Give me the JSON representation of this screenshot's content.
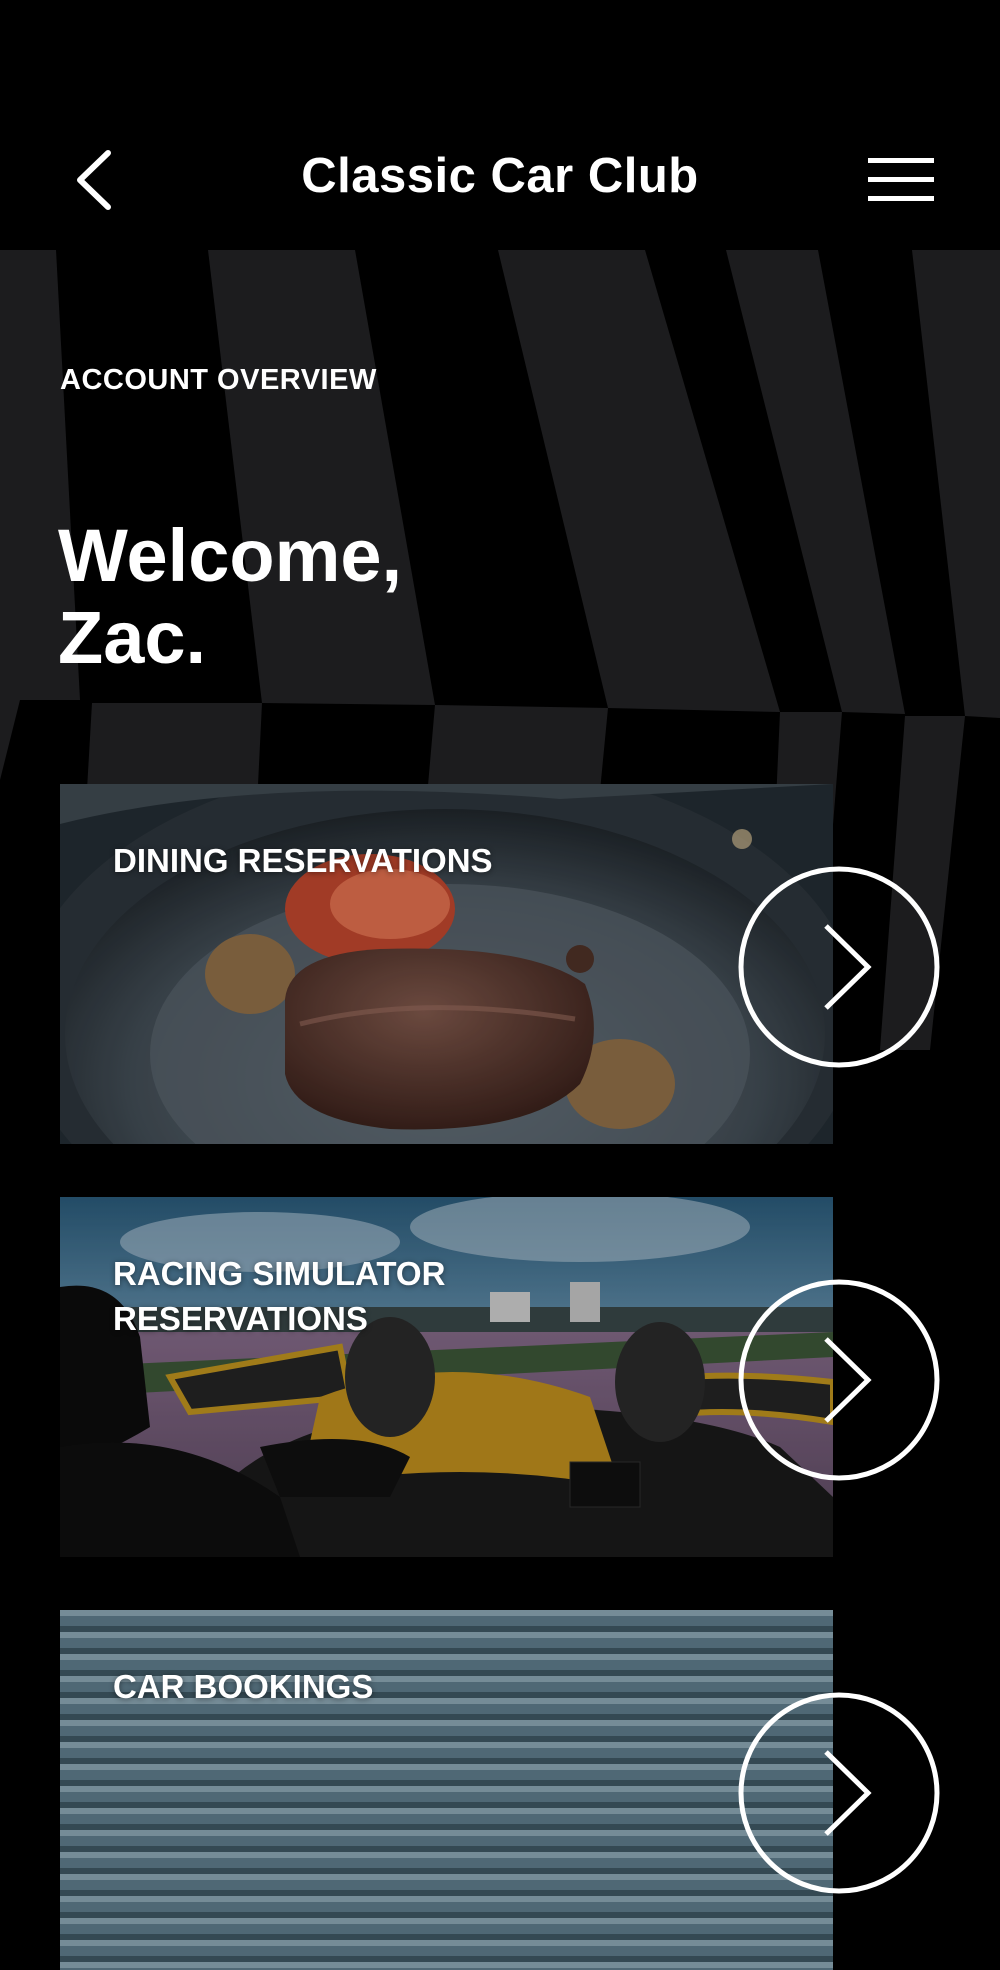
{
  "header": {
    "title": "Classic Car Club",
    "back_icon": "chevron-left-icon",
    "menu_icon": "hamburger-menu-icon"
  },
  "account": {
    "eyebrow": "ACCOUNT OVERVIEW",
    "welcome_line1": "Welcome,",
    "welcome_line2": "Zac."
  },
  "cards": [
    {
      "label": "DINING RESERVATIONS",
      "image": "steak-dish-photo",
      "icon": "chevron-right-circle-icon"
    },
    {
      "label_line1": "RACING SIMULATOR",
      "label_line2": "RESERVATIONS",
      "image": "racing-simulator-photo",
      "icon": "chevron-right-circle-icon"
    },
    {
      "label": "CAR BOOKINGS",
      "image": "garage-door-photo",
      "icon": "chevron-right-circle-icon"
    }
  ],
  "colors": {
    "background": "#000000",
    "stripe": "#1c1c1e",
    "text": "#ffffff"
  }
}
